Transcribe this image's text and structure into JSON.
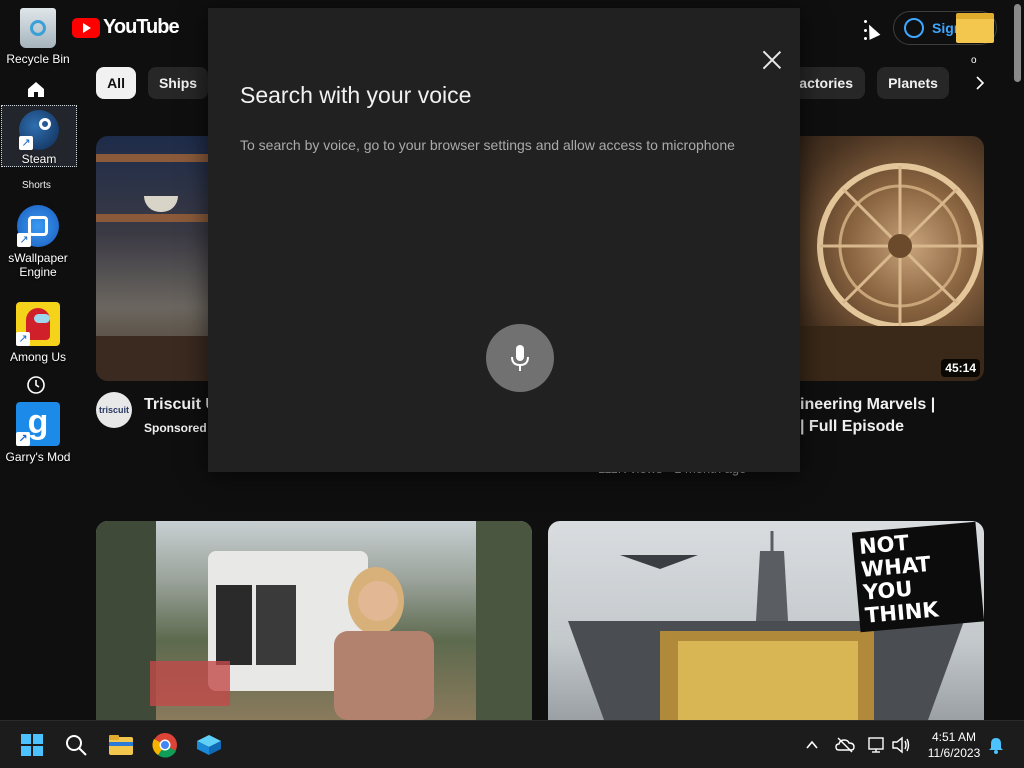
{
  "youtube": {
    "logo_text": "YouTube",
    "sign_in_label": "Sign in",
    "chips": [
      "All",
      "Ships",
      "Factories",
      "Planets"
    ],
    "sidebar_shorts_label": "Shorts",
    "stray_mark": "o"
  },
  "videos": [
    {
      "title": "Triscuit U",
      "channel_avatar_text": "triscuit",
      "badge": "Sponsored"
    },
    {
      "title_line1": "ineering Marvels |",
      "title_line2": "| Full Episode",
      "meta": "111K views · 1 month ago",
      "duration": "45:14"
    },
    {
      "overlay_text_line1": "NOT WHAT",
      "overlay_text_line2": "YOU THINK"
    }
  ],
  "modal": {
    "title": "Search with your voice",
    "message": "To search by voice, go to your browser settings and allow access to microphone"
  },
  "desktop_icons": [
    {
      "label": "Recycle Bin"
    },
    {
      "label": "Steam"
    },
    {
      "label": "sWallpaper Engine"
    },
    {
      "label": "Among Us"
    },
    {
      "label": "Garry's Mod"
    }
  ],
  "taskbar": {
    "time": "4:51 AM",
    "date": "11/6/2023"
  },
  "colors": {
    "yt_red": "#ff0000",
    "background": "#0f0f0f",
    "modal_bg": "#212121",
    "link_blue": "#3ea6ff"
  }
}
